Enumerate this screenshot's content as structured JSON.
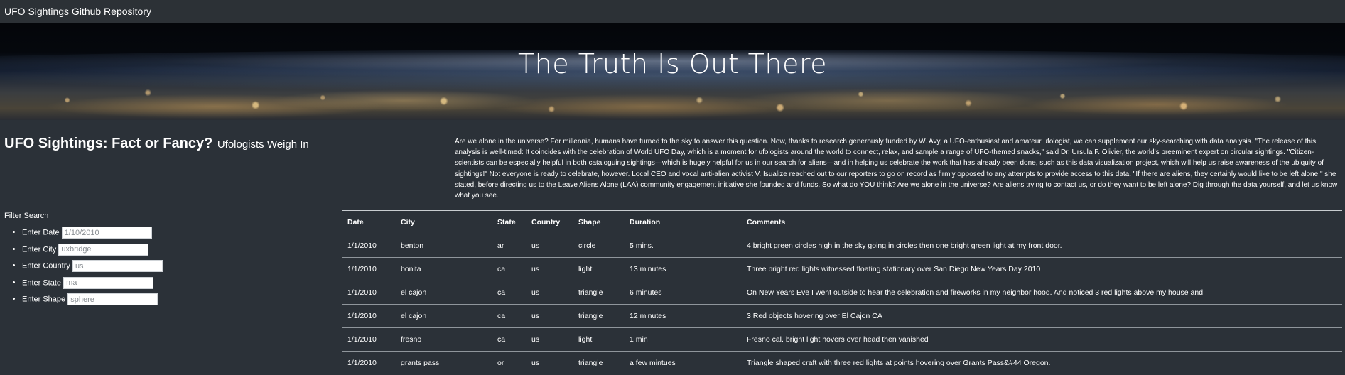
{
  "navbar": {
    "brand": "UFO Sightings Github Repository"
  },
  "hero": {
    "title": "The Truth Is Out There"
  },
  "article": {
    "title": "UFO Sightings: Fact or Fancy?",
    "subtitle": "Ufologists Weigh In",
    "intro": "Are we alone in the universe? For millennia, humans have turned to the sky to answer this question. Now, thanks to research generously funded by W. Avy, a UFO-enthusiast and amateur ufologist, we can supplement our sky-searching with data analysis. \"The release of this analysis is well-timed: It coincides with the celebration of World UFO Day, which is a moment for ufologists around the world to connect, relax, and sample a range of UFO-themed snacks,\" said Dr. Ursula F. Olivier, the world's preeminent expert on circular sightings. \"Citizen-scientists can be especially helpful in both cataloguing sightings—which is hugely helpful for us in our search for aliens—and in helping us celebrate the work that has already been done, such as this data visualization project, which will help us raise awareness of the ubiquity of sightings!\" Not everyone is ready to celebrate, however. Local CEO and vocal anti-alien activist V. Isualize reached out to our reporters to go on record as firmly opposed to any attempts to provide access to this data. \"If there are aliens, they certainly would like to be left alone,\" she stated, before directing us to the Leave Aliens Alone (LAA) community engagement initiative she founded and funds. So what do YOU think? Are we alone in the universe? Are aliens trying to contact us, or do they want to be left alone? Dig through the data yourself, and let us know what you see."
  },
  "filters": {
    "label": "Filter Search",
    "date": {
      "label": "Enter Date",
      "placeholder": "1/10/2010"
    },
    "city": {
      "label": "Enter City",
      "placeholder": "uxbridge"
    },
    "country": {
      "label": "Enter Country",
      "placeholder": "us"
    },
    "state": {
      "label": "Enter State",
      "placeholder": "ma"
    },
    "shape": {
      "label": "Enter Shape",
      "placeholder": "sphere"
    }
  },
  "table": {
    "headers": [
      "Date",
      "City",
      "State",
      "Country",
      "Shape",
      "Duration",
      "Comments"
    ],
    "rows": [
      [
        "1/1/2010",
        "benton",
        "ar",
        "us",
        "circle",
        "5 mins.",
        "4 bright green circles high in the sky going in circles then one bright green light at my front door."
      ],
      [
        "1/1/2010",
        "bonita",
        "ca",
        "us",
        "light",
        "13 minutes",
        "Three bright red lights witnessed floating stationary over San Diego New Years Day 2010"
      ],
      [
        "1/1/2010",
        "el cajon",
        "ca",
        "us",
        "triangle",
        "6 minutes",
        "On New Years Eve I went outside to hear the celebration and fireworks in my neighbor hood. And noticed 3 red lights above my house and"
      ],
      [
        "1/1/2010",
        "el cajon",
        "ca",
        "us",
        "triangle",
        "12 minutes",
        "3 Red objects hovering over El Cajon CA"
      ],
      [
        "1/1/2010",
        "fresno",
        "ca",
        "us",
        "light",
        "1 min",
        "Fresno cal. bright light hovers over head then vanished"
      ],
      [
        "1/1/2010",
        "grants pass",
        "or",
        "us",
        "triangle",
        "a few mintues",
        "Triangle shaped craft with three red lights at points hovering over Grants Pass&#44 Oregon."
      ]
    ]
  }
}
